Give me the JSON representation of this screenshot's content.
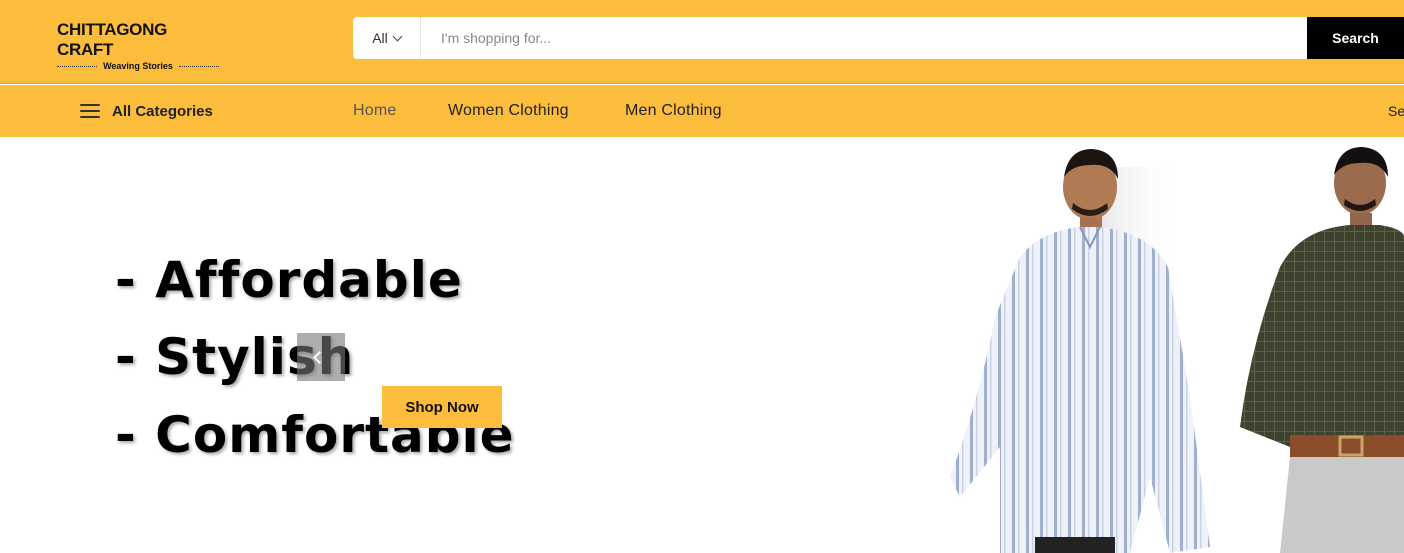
{
  "header": {
    "logo": {
      "title": "CHITTAGONG CRAFT",
      "tagline": "Weaving Stories"
    },
    "search": {
      "category": "All",
      "placeholder": "I'm shopping for...",
      "button_label": "Search"
    }
  },
  "nav": {
    "all_categories": "All Categories",
    "items": [
      {
        "label": "Home",
        "active": true
      },
      {
        "label": "Women Clothing"
      },
      {
        "label": "Men Clothing"
      }
    ],
    "right_cut": "Se"
  },
  "hero": {
    "lines": [
      "- Affordable",
      "- Stylish",
      "- Comfortable"
    ],
    "cta": "Shop Now",
    "icons": {
      "prev": "chevron-left-icon",
      "menu": "hamburger-menu-icon"
    }
  },
  "colors": {
    "brand": "#fdbd3c",
    "search_button": "#000000",
    "text": "#111111"
  }
}
